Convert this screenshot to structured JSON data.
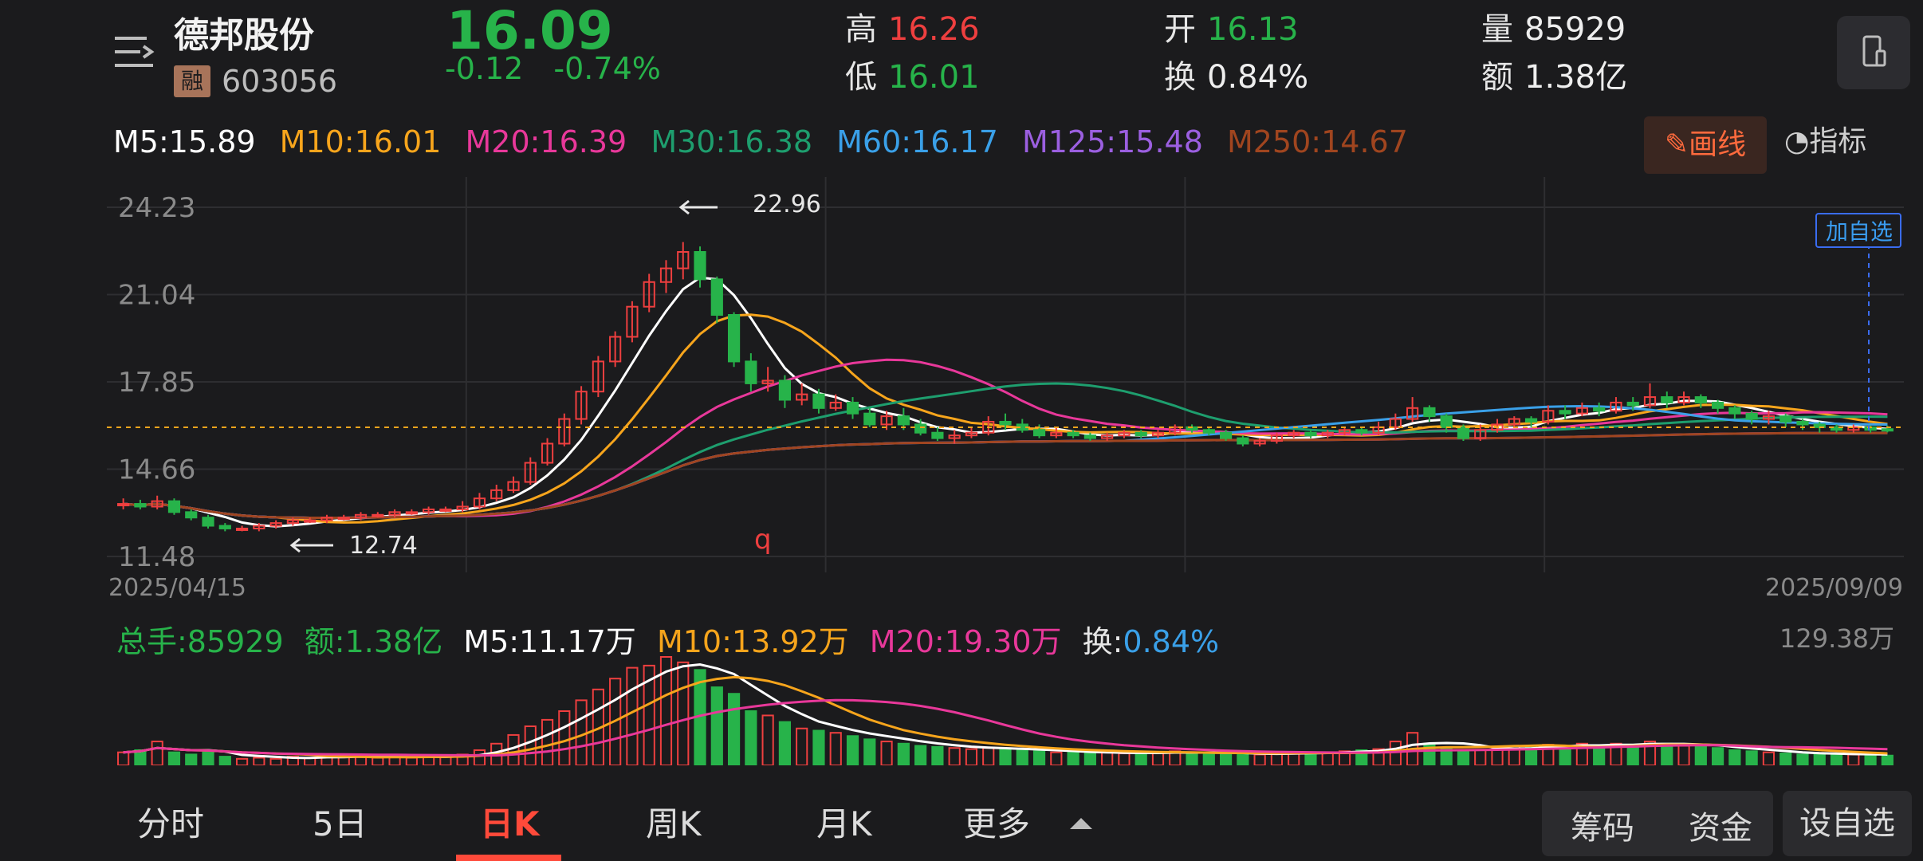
{
  "stock": {
    "name": "德邦股份",
    "margin_badge": "融",
    "code": "603056",
    "price": "16.09",
    "change": "-0.12",
    "change_pct": "-0.74%"
  },
  "quote": {
    "high_label": "高",
    "high": "16.26",
    "low_label": "低",
    "low": "16.01",
    "open_label": "开",
    "open": "16.13",
    "turnover_label": "换",
    "turnover": "0.84%",
    "volume_label": "量",
    "volume": "85929",
    "amount_label": "额",
    "amount": "1.38亿"
  },
  "ma": {
    "m5": "M5:15.89",
    "m10": "M10:16.01",
    "m20": "M20:16.39",
    "m30": "M30:16.38",
    "m60": "M60:16.17",
    "m125": "M125:15.48",
    "m250": "M250:14.67"
  },
  "toolbar": {
    "draw_line": "画线",
    "indicator": "指标",
    "add_watch": "加自选"
  },
  "colors": {
    "up": "#ee3f3f",
    "down": "#27b34a",
    "accent": "#ff4a3a",
    "m5": "#ffffff",
    "m10": "#f7a51c",
    "m20": "#e8389a",
    "m30": "#1e9e6e",
    "m60": "#3aa0e8",
    "m125": "#9b5fe0",
    "m250": "#a0451f"
  },
  "chart_data": {
    "type": "candlestick",
    "y_ticks": [
      "24.23",
      "21.04",
      "17.85",
      "14.66",
      "11.48"
    ],
    "ylim": [
      11.48,
      24.23
    ],
    "x_start": "2025/04/15",
    "x_end": "2025/09/09",
    "annotations": {
      "max": "22.96",
      "min": "12.74",
      "q": "q"
    },
    "candles": [
      [
        13.35,
        13.4,
        13.6,
        13.2
      ],
      [
        13.4,
        13.3,
        13.55,
        13.2
      ],
      [
        13.3,
        13.5,
        13.7,
        13.2
      ],
      [
        13.5,
        13.1,
        13.6,
        13.0
      ],
      [
        13.1,
        12.9,
        13.2,
        12.8
      ],
      [
        12.9,
        12.6,
        13.0,
        12.5
      ],
      [
        12.6,
        12.5,
        12.7,
        12.4
      ],
      [
        12.5,
        12.5,
        12.6,
        12.4
      ],
      [
        12.5,
        12.6,
        12.7,
        12.4
      ],
      [
        12.6,
        12.7,
        12.8,
        12.5
      ],
      [
        12.7,
        12.8,
        12.9,
        12.6
      ],
      [
        12.8,
        12.8,
        12.9,
        12.7
      ],
      [
        12.8,
        12.9,
        13.0,
        12.7
      ],
      [
        12.9,
        12.9,
        13.0,
        12.8
      ],
      [
        12.9,
        13.0,
        13.1,
        12.8
      ],
      [
        13.0,
        13.0,
        13.1,
        12.9
      ],
      [
        13.0,
        13.1,
        13.2,
        12.9
      ],
      [
        13.1,
        13.1,
        13.2,
        13.0
      ],
      [
        13.1,
        13.2,
        13.3,
        13.0
      ],
      [
        13.2,
        13.2,
        13.3,
        13.1
      ],
      [
        13.2,
        13.3,
        13.5,
        13.1
      ],
      [
        13.3,
        13.6,
        13.8,
        13.2
      ],
      [
        13.6,
        13.9,
        14.1,
        13.5
      ],
      [
        13.9,
        14.2,
        14.4,
        13.8
      ],
      [
        14.2,
        14.9,
        15.1,
        14.1
      ],
      [
        14.9,
        15.6,
        15.8,
        14.8
      ],
      [
        15.6,
        16.5,
        16.7,
        15.5
      ],
      [
        16.5,
        17.5,
        17.7,
        16.3
      ],
      [
        17.5,
        18.6,
        18.8,
        17.3
      ],
      [
        18.6,
        19.5,
        19.7,
        18.4
      ],
      [
        19.5,
        20.6,
        20.8,
        19.3
      ],
      [
        20.6,
        21.5,
        21.8,
        20.4
      ],
      [
        21.5,
        22.0,
        22.3,
        21.1
      ],
      [
        22.0,
        22.6,
        22.96,
        21.6
      ],
      [
        22.6,
        21.6,
        22.8,
        21.3
      ],
      [
        21.6,
        20.3,
        21.7,
        20.0
      ],
      [
        20.3,
        18.6,
        20.4,
        18.4
      ],
      [
        18.6,
        17.8,
        18.9,
        17.5
      ],
      [
        17.8,
        17.9,
        18.4,
        17.5
      ],
      [
        17.9,
        17.2,
        18.1,
        16.9
      ],
      [
        17.2,
        17.4,
        17.8,
        17.0
      ],
      [
        17.4,
        16.9,
        17.6,
        16.7
      ],
      [
        16.9,
        17.1,
        17.4,
        16.8
      ],
      [
        17.1,
        16.7,
        17.3,
        16.5
      ],
      [
        16.7,
        16.3,
        16.9,
        16.2
      ],
      [
        16.3,
        16.6,
        16.8,
        16.1
      ],
      [
        16.6,
        16.3,
        16.9,
        16.1
      ],
      [
        16.3,
        16.0,
        16.5,
        15.9
      ],
      [
        16.0,
        15.8,
        16.2,
        15.7
      ],
      [
        15.8,
        15.9,
        16.1,
        15.6
      ],
      [
        15.9,
        16.0,
        16.2,
        15.8
      ],
      [
        16.0,
        16.4,
        16.6,
        15.9
      ],
      [
        16.4,
        16.3,
        16.7,
        16.1
      ],
      [
        16.3,
        16.1,
        16.5,
        16.0
      ],
      [
        16.1,
        15.9,
        16.3,
        15.8
      ],
      [
        15.9,
        16.0,
        16.2,
        15.8
      ],
      [
        16.0,
        15.9,
        16.1,
        15.8
      ],
      [
        15.9,
        15.8,
        16.0,
        15.7
      ],
      [
        15.8,
        15.9,
        16.0,
        15.7
      ],
      [
        15.9,
        16.0,
        16.1,
        15.8
      ],
      [
        16.0,
        15.9,
        16.1,
        15.8
      ],
      [
        15.9,
        16.0,
        16.1,
        15.8
      ],
      [
        16.0,
        16.2,
        16.3,
        15.9
      ],
      [
        16.2,
        16.1,
        16.3,
        16.0
      ],
      [
        16.1,
        16.0,
        16.2,
        15.9
      ],
      [
        16.0,
        15.8,
        16.1,
        15.7
      ],
      [
        15.8,
        15.6,
        15.9,
        15.5
      ],
      [
        15.6,
        15.7,
        15.8,
        15.5
      ],
      [
        15.7,
        15.9,
        16.0,
        15.6
      ],
      [
        15.9,
        16.0,
        16.1,
        15.8
      ],
      [
        16.0,
        15.9,
        16.1,
        15.8
      ],
      [
        15.9,
        16.0,
        16.1,
        15.8
      ],
      [
        16.0,
        16.1,
        16.2,
        15.9
      ],
      [
        16.1,
        16.0,
        16.2,
        15.9
      ],
      [
        16.0,
        16.2,
        16.4,
        15.9
      ],
      [
        16.2,
        16.5,
        16.7,
        16.1
      ],
      [
        16.5,
        16.9,
        17.3,
        16.4
      ],
      [
        16.9,
        16.6,
        17.0,
        16.4
      ],
      [
        16.6,
        16.2,
        16.7,
        16.0
      ],
      [
        16.2,
        15.8,
        16.3,
        15.7
      ],
      [
        15.8,
        16.1,
        16.3,
        15.7
      ],
      [
        16.1,
        16.3,
        16.5,
        16.0
      ],
      [
        16.3,
        16.5,
        16.6,
        16.2
      ],
      [
        16.5,
        16.4,
        16.6,
        16.2
      ],
      [
        16.4,
        16.8,
        17.0,
        16.3
      ],
      [
        16.8,
        16.7,
        17.0,
        16.5
      ],
      [
        16.7,
        16.9,
        17.1,
        16.6
      ],
      [
        16.9,
        16.8,
        17.1,
        16.6
      ],
      [
        16.8,
        17.1,
        17.3,
        16.7
      ],
      [
        17.1,
        17.0,
        17.3,
        16.8
      ],
      [
        17.0,
        17.3,
        17.8,
        16.9
      ],
      [
        17.3,
        17.1,
        17.5,
        16.9
      ],
      [
        17.1,
        17.3,
        17.5,
        17.0
      ],
      [
        17.3,
        17.1,
        17.4,
        16.9
      ],
      [
        17.1,
        16.9,
        17.2,
        16.7
      ],
      [
        16.9,
        16.7,
        17.0,
        16.5
      ],
      [
        16.7,
        16.5,
        16.8,
        16.3
      ],
      [
        16.5,
        16.6,
        16.8,
        16.3
      ],
      [
        16.6,
        16.4,
        16.7,
        16.2
      ],
      [
        16.4,
        16.3,
        16.5,
        16.1
      ],
      [
        16.3,
        16.2,
        16.4,
        16.0
      ],
      [
        16.2,
        16.1,
        16.3,
        16.0
      ],
      [
        16.1,
        16.2,
        16.3,
        16.0
      ],
      [
        16.2,
        16.1,
        16.26,
        16.0
      ],
      [
        16.13,
        16.09,
        16.26,
        16.01
      ]
    ],
    "volumes": [
      0.12,
      0.14,
      0.22,
      0.12,
      0.1,
      0.12,
      0.08,
      0.06,
      0.07,
      0.06,
      0.08,
      0.07,
      0.09,
      0.08,
      0.08,
      0.07,
      0.09,
      0.07,
      0.08,
      0.08,
      0.1,
      0.14,
      0.2,
      0.28,
      0.36,
      0.42,
      0.5,
      0.6,
      0.7,
      0.8,
      0.9,
      0.92,
      1.0,
      0.95,
      0.88,
      0.72,
      0.66,
      0.5,
      0.46,
      0.4,
      0.34,
      0.32,
      0.3,
      0.27,
      0.24,
      0.22,
      0.2,
      0.18,
      0.17,
      0.16,
      0.15,
      0.16,
      0.15,
      0.14,
      0.13,
      0.12,
      0.12,
      0.11,
      0.12,
      0.11,
      0.11,
      0.12,
      0.13,
      0.12,
      0.11,
      0.1,
      0.11,
      0.1,
      0.11,
      0.12,
      0.12,
      0.12,
      0.13,
      0.14,
      0.15,
      0.22,
      0.3,
      0.2,
      0.16,
      0.13,
      0.14,
      0.16,
      0.18,
      0.17,
      0.19,
      0.18,
      0.2,
      0.18,
      0.2,
      0.19,
      0.22,
      0.2,
      0.18,
      0.17,
      0.16,
      0.14,
      0.13,
      0.12,
      0.11,
      0.1,
      0.1,
      0.11,
      0.1,
      0.1,
      0.09
    ]
  },
  "volume": {
    "total": "总手:85929",
    "amount": "额:1.38亿",
    "m5": "M5:11.17万",
    "m10": "M10:13.92万",
    "m20": "M20:19.30万",
    "turnover_label": "换:",
    "turnover": "0.84%",
    "max": "129.38万"
  },
  "tabs": {
    "intraday": "分时",
    "five_day": "5日",
    "daily": "日K",
    "weekly": "周K",
    "monthly": "月K",
    "more": "更多"
  },
  "bottom": {
    "chips": "筹码",
    "funds": "资金",
    "add_watch": "设自选"
  }
}
